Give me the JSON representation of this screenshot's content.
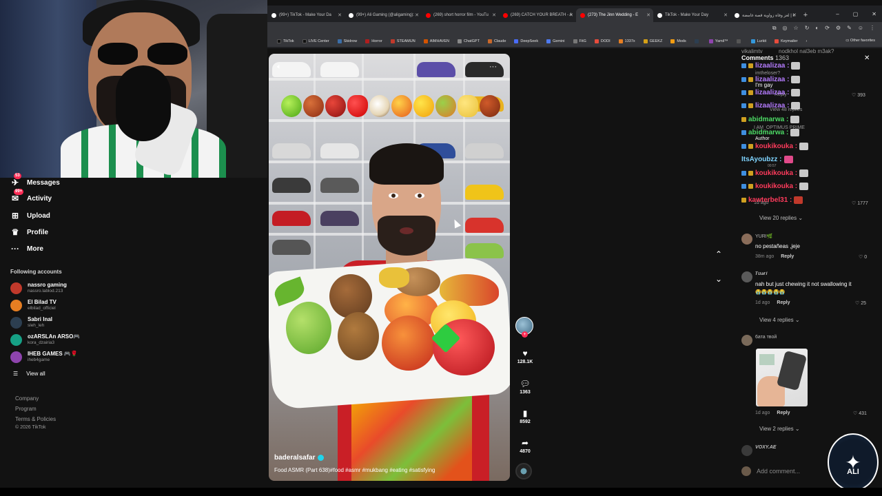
{
  "browser": {
    "tabs": [
      {
        "label": "(99+) TikTok - Make Your Da",
        "fav": "#ffffff",
        "active": false
      },
      {
        "label": "(99+) Ali Gaming (@aligaming):",
        "fav": "#ffffff",
        "active": false
      },
      {
        "label": "(269) short horror film - YouTu",
        "fav": "#ff0000",
        "active": false
      },
      {
        "label": "(269) CATCH YOUR BREATH - A",
        "fav": "#ff0000",
        "active": false
      },
      {
        "label": "(273) The Jinn Wedding - E",
        "fav": "#ff0000",
        "active": true
      },
      {
        "label": "TikTok - Make Your Day",
        "fav": "#ffffff",
        "active": false
      },
      {
        "label": "لغز وفاة زواوية قصة غامضة | k",
        "fav": "#ffffff",
        "active": false
      }
    ],
    "new_tab": "+",
    "window_controls": [
      "–",
      "▢",
      "✕"
    ],
    "toolbar_icons": [
      "⧉",
      "◎",
      "☆",
      "↻",
      "◐",
      "⟳",
      "⚙",
      "✎",
      "☺",
      "⋮"
    ],
    "bookmarks": [
      {
        "label": "TikTok",
        "color": "#111111"
      },
      {
        "label": "LIVE Center",
        "color": "#111111"
      },
      {
        "label": "Skidrow",
        "color": "#3b6ea8"
      },
      {
        "label": "Horror",
        "color": "#b01e1e"
      },
      {
        "label": "STEAMUN",
        "color": "#c0392b"
      },
      {
        "label": "AIMHAVEN",
        "color": "#d35400"
      },
      {
        "label": "ChatGPT",
        "color": "#888888"
      },
      {
        "label": "Claude",
        "color": "#c9682a"
      },
      {
        "label": "DeepSeek",
        "color": "#4a6cf7"
      },
      {
        "label": "Gemini",
        "color": "#4e7af0"
      },
      {
        "label": "FitG",
        "color": "#777777"
      },
      {
        "label": "DODI",
        "color": "#e74c3c"
      },
      {
        "label": "1337x",
        "color": "#e67e22"
      },
      {
        "label": "GEEKZ",
        "color": "#d4a017"
      },
      {
        "label": "Mods",
        "color": "#f39c12"
      },
      {
        "label": "",
        "color": "#2c3e50"
      },
      {
        "label": "Yamil™",
        "color": "#8e44ad"
      },
      {
        "label": "",
        "color": "#555555"
      },
      {
        "label": "Lurkit",
        "color": "#3498db"
      },
      {
        "label": "Keymailer",
        "color": "#e74c3c"
      }
    ],
    "bookmarks_more": "›",
    "other_favorites": "Other favorites"
  },
  "sidebar": {
    "nav": [
      {
        "label": "Messages",
        "icon": "messages-icon",
        "glyph": "✈",
        "badge": "53"
      },
      {
        "label": "Activity",
        "icon": "activity-icon",
        "glyph": "✉",
        "badge": "99+"
      },
      {
        "label": "Upload",
        "icon": "upload-icon",
        "glyph": "⊞",
        "badge": ""
      },
      {
        "label": "Profile",
        "icon": "profile-icon",
        "glyph": "♛",
        "badge": ""
      },
      {
        "label": "More",
        "icon": "more-icon",
        "glyph": "···",
        "badge": ""
      }
    ],
    "following_title": "Following accounts",
    "accounts": [
      {
        "name": "nassro gaming",
        "handle": "nassro.lablod.213",
        "color": "#c0392b"
      },
      {
        "name": "El Bilad TV",
        "handle": "elbilad_officiel",
        "color": "#e67e22"
      },
      {
        "name": "Sabri Inal",
        "handle": "sleh_leh",
        "color": "#2c3e50"
      },
      {
        "name": "ozARSLAn ARSO🎮",
        "handle": "kora_dzairia3",
        "color": "#16a085"
      },
      {
        "name": "IHEB GAMES 🎮🌹",
        "handle": "iheb4game",
        "color": "#8e44ad"
      }
    ],
    "view_all": "View all",
    "footer": [
      "Company",
      "Program",
      "Terms & Policies",
      "© 2026 TikTok"
    ]
  },
  "video": {
    "username": "baderalsafar",
    "caption": "Food ASMR (Part 638)#food #asmr #mukbang #eating #satisfying",
    "actions": {
      "likes": "128.1K",
      "comments": "1363",
      "saves": "8592",
      "shares": "4870"
    }
  },
  "comments": {
    "title": "Comments",
    "count": "1363",
    "close": "✕",
    "chat_overlay": [
      {
        "user": "lizaalizaa :",
        "color": "#b57cff"
      },
      {
        "user": "lizaalizaa :",
        "color": "#b57cff"
      },
      {
        "user": "lizaalizaa :",
        "color": "#b57cff"
      },
      {
        "user": "lizaalizaa :",
        "color": "#b57cff"
      },
      {
        "user": "abidmarwa :",
        "color": "#4cd964"
      },
      {
        "user": "abidmarwa :",
        "color": "#4cd964"
      },
      {
        "user": "koukikouka :",
        "color": "#ff3b5c"
      },
      {
        "user": "ItsAyoubzz :",
        "color": "#7fd4ff"
      },
      {
        "user": "koukikouka :",
        "color": "#ff3b5c"
      },
      {
        "user": "koukikouka :",
        "color": "#ff3b5c"
      },
      {
        "user": "kawterbel31 :",
        "color": "#ff3b5c"
      }
    ],
    "ghost_texts": {
      "top": "nodkhol nal3eb m3ak?",
      "top_user": "vikalimtv",
      "im_the_loser": "imtheloser?",
      "im_gay": "I'm gay",
      "reply1": "Reply",
      "view48": "View 48 replies",
      "optimus": "I AM_OPTIMUS PRIME",
      "author": "Author",
      "time": "00:57",
      "ago": "1d ago"
    },
    "likes_393": "393",
    "likes_1777": "1777",
    "view20": "View 20 replies",
    "items": [
      {
        "user": "YURI🌿",
        "text": "no pestañeas ,jeje",
        "time": "38m ago",
        "likes": "0",
        "color": "#8a6d5a"
      },
      {
        "user": "𝑻𝒖𝒂𝒓𝒊",
        "text": "nah but just chewing it not swallowing it",
        "emoji": "😭😭😭😭😭",
        "time": "1d ago",
        "likes": "25",
        "color": "#5a5a5a"
      },
      {
        "user": "6ата твой",
        "text": "",
        "time": "1d ago",
        "likes": "431",
        "color": "#7a6a5a"
      },
      {
        "user": "VOXY.AE",
        "text": "",
        "time": "",
        "likes": "",
        "color": "#3a3a3a"
      }
    ],
    "reply_label": "Reply",
    "view4": "View 4 replies",
    "view2": "View 2 replies",
    "add_placeholder": "Add comment..."
  },
  "logo_text": "ALI"
}
